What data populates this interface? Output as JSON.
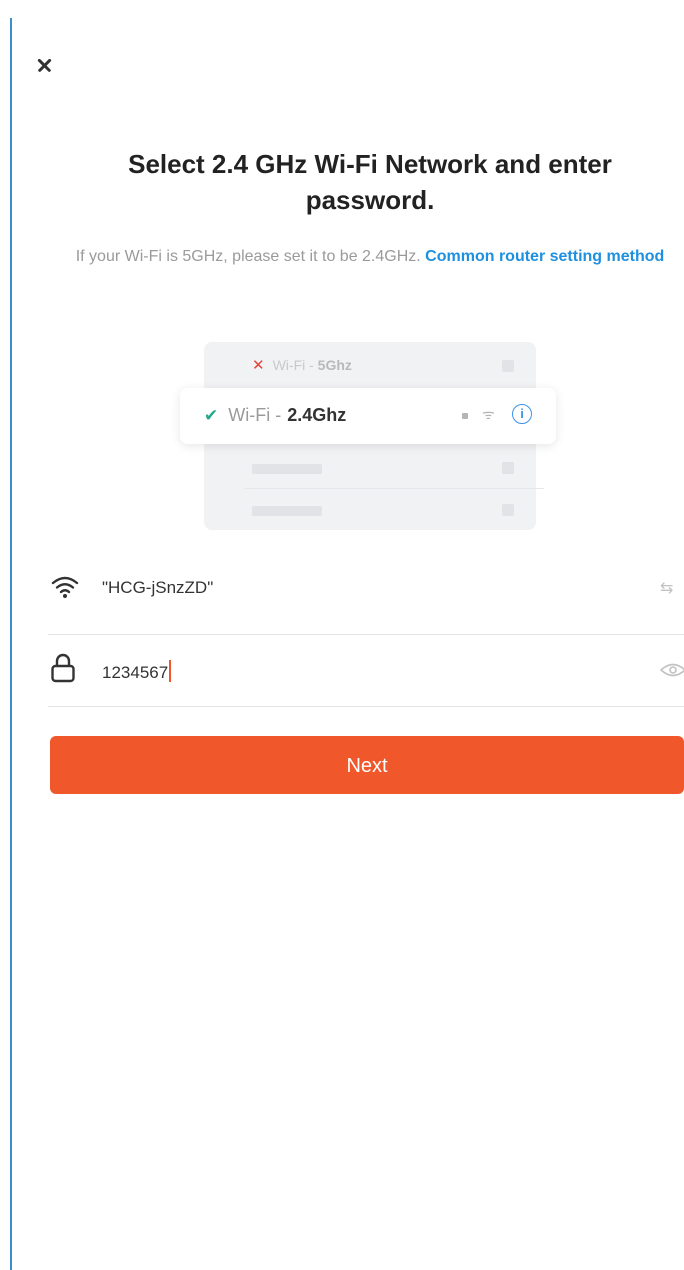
{
  "header": {
    "close_icon": "close-icon"
  },
  "title": "Select 2.4 GHz Wi-Fi Network and enter password.",
  "subtitle": {
    "text": "If your Wi-Fi is 5GHz, please set it to be 2.4GHz. ",
    "link": "Common router setting method"
  },
  "illustration": {
    "network_5g": {
      "prefix": "Wi-Fi - ",
      "band": "5Ghz",
      "status_icon": "cross-icon"
    },
    "network_24g": {
      "prefix": "Wi-Fi - ",
      "band": "2.4Ghz",
      "status_icon": "check-icon"
    },
    "info_glyph": "i"
  },
  "form": {
    "ssid": {
      "value": "\"HCG-jSnzZD\"",
      "icon": "wifi-icon",
      "action_icon": "swap-icon"
    },
    "password": {
      "value": "1234567",
      "icon": "lock-icon",
      "action_icon": "eye-icon"
    }
  },
  "next_button": {
    "label": "Next"
  },
  "colors": {
    "accent": "#f0572a",
    "link": "#1e90e0",
    "check": "#23a98f",
    "error": "#e8453c"
  }
}
